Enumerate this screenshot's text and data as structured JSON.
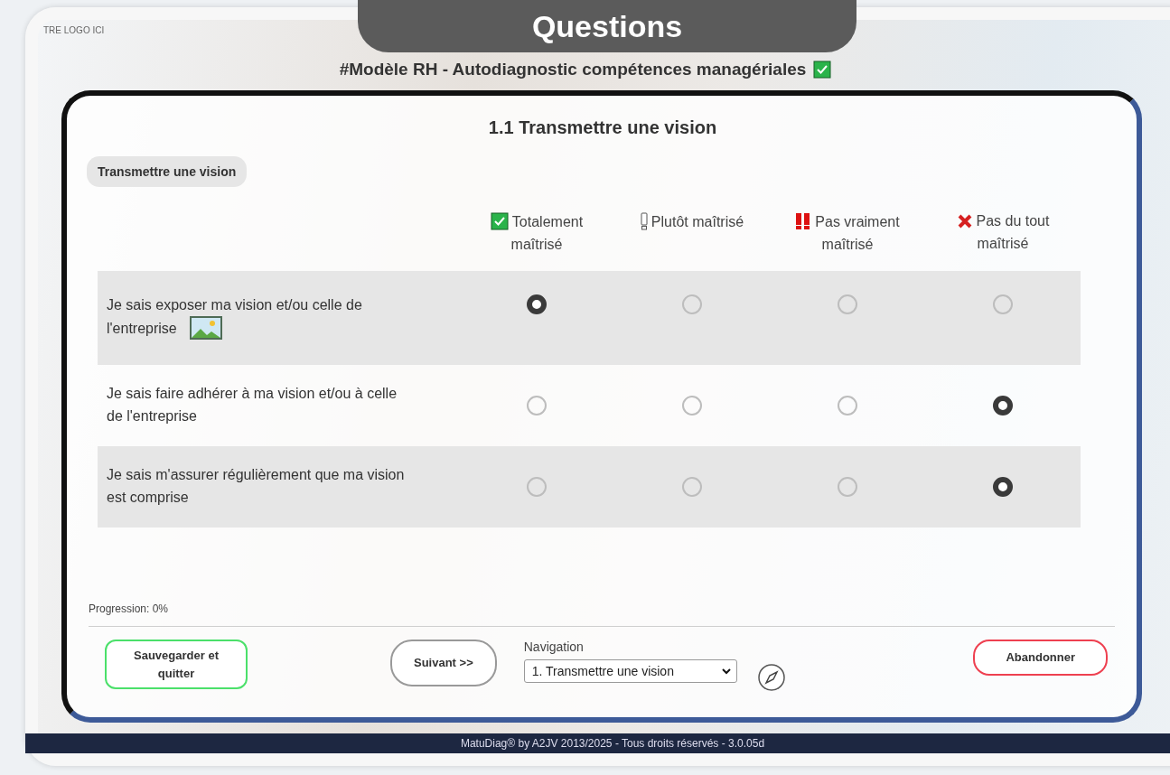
{
  "banner": {
    "title": "Questions"
  },
  "logo": {
    "text": "TRE LOGO ICI"
  },
  "header": {
    "title": "#Modèle RH - Autodiagnostic compétences managériales",
    "badge_checked": true
  },
  "section": {
    "title": "1.1 Transmettre une vision",
    "chip": "Transmettre une vision"
  },
  "columns": [
    {
      "kind": "check",
      "label": "Totalement maîtrisé"
    },
    {
      "kind": "warn",
      "label": "Plutôt maîtrisé"
    },
    {
      "kind": "double-warn",
      "label": "Pas vraiment maîtrisé"
    },
    {
      "kind": "cross",
      "label": "Pas du tout maîtrisé"
    }
  ],
  "rows": [
    {
      "text": "Je sais exposer ma vision et/ou celle de l'entreprise",
      "image": true,
      "options": [
        {
          "selected": true
        },
        {
          "selected": false
        },
        {
          "selected": false
        },
        {
          "selected": false
        }
      ]
    },
    {
      "text": "Je sais faire adhérer à ma vision et/ou à celle de l'entreprise",
      "image": false,
      "options": [
        {
          "selected": false
        },
        {
          "selected": false
        },
        {
          "selected": false
        },
        {
          "selected": true
        }
      ]
    },
    {
      "text": "Je sais m'assurer régulièrement que ma vision est comprise",
      "image": false,
      "options": [
        {
          "selected": false
        },
        {
          "selected": false
        },
        {
          "selected": false
        },
        {
          "selected": true
        }
      ]
    }
  ],
  "progress": {
    "text": "Progression: 0%"
  },
  "buttons": {
    "save": "Sauvegarder et quitter",
    "next": "Suivant >>",
    "abandon": "Abandonner"
  },
  "navigation": {
    "label": "Navigation",
    "value": "1. Transmettre une vision"
  },
  "footer": {
    "text": "MatuDiag® by A2JV 2013/2025 - Tous droits réservés - 3.0.05d"
  }
}
